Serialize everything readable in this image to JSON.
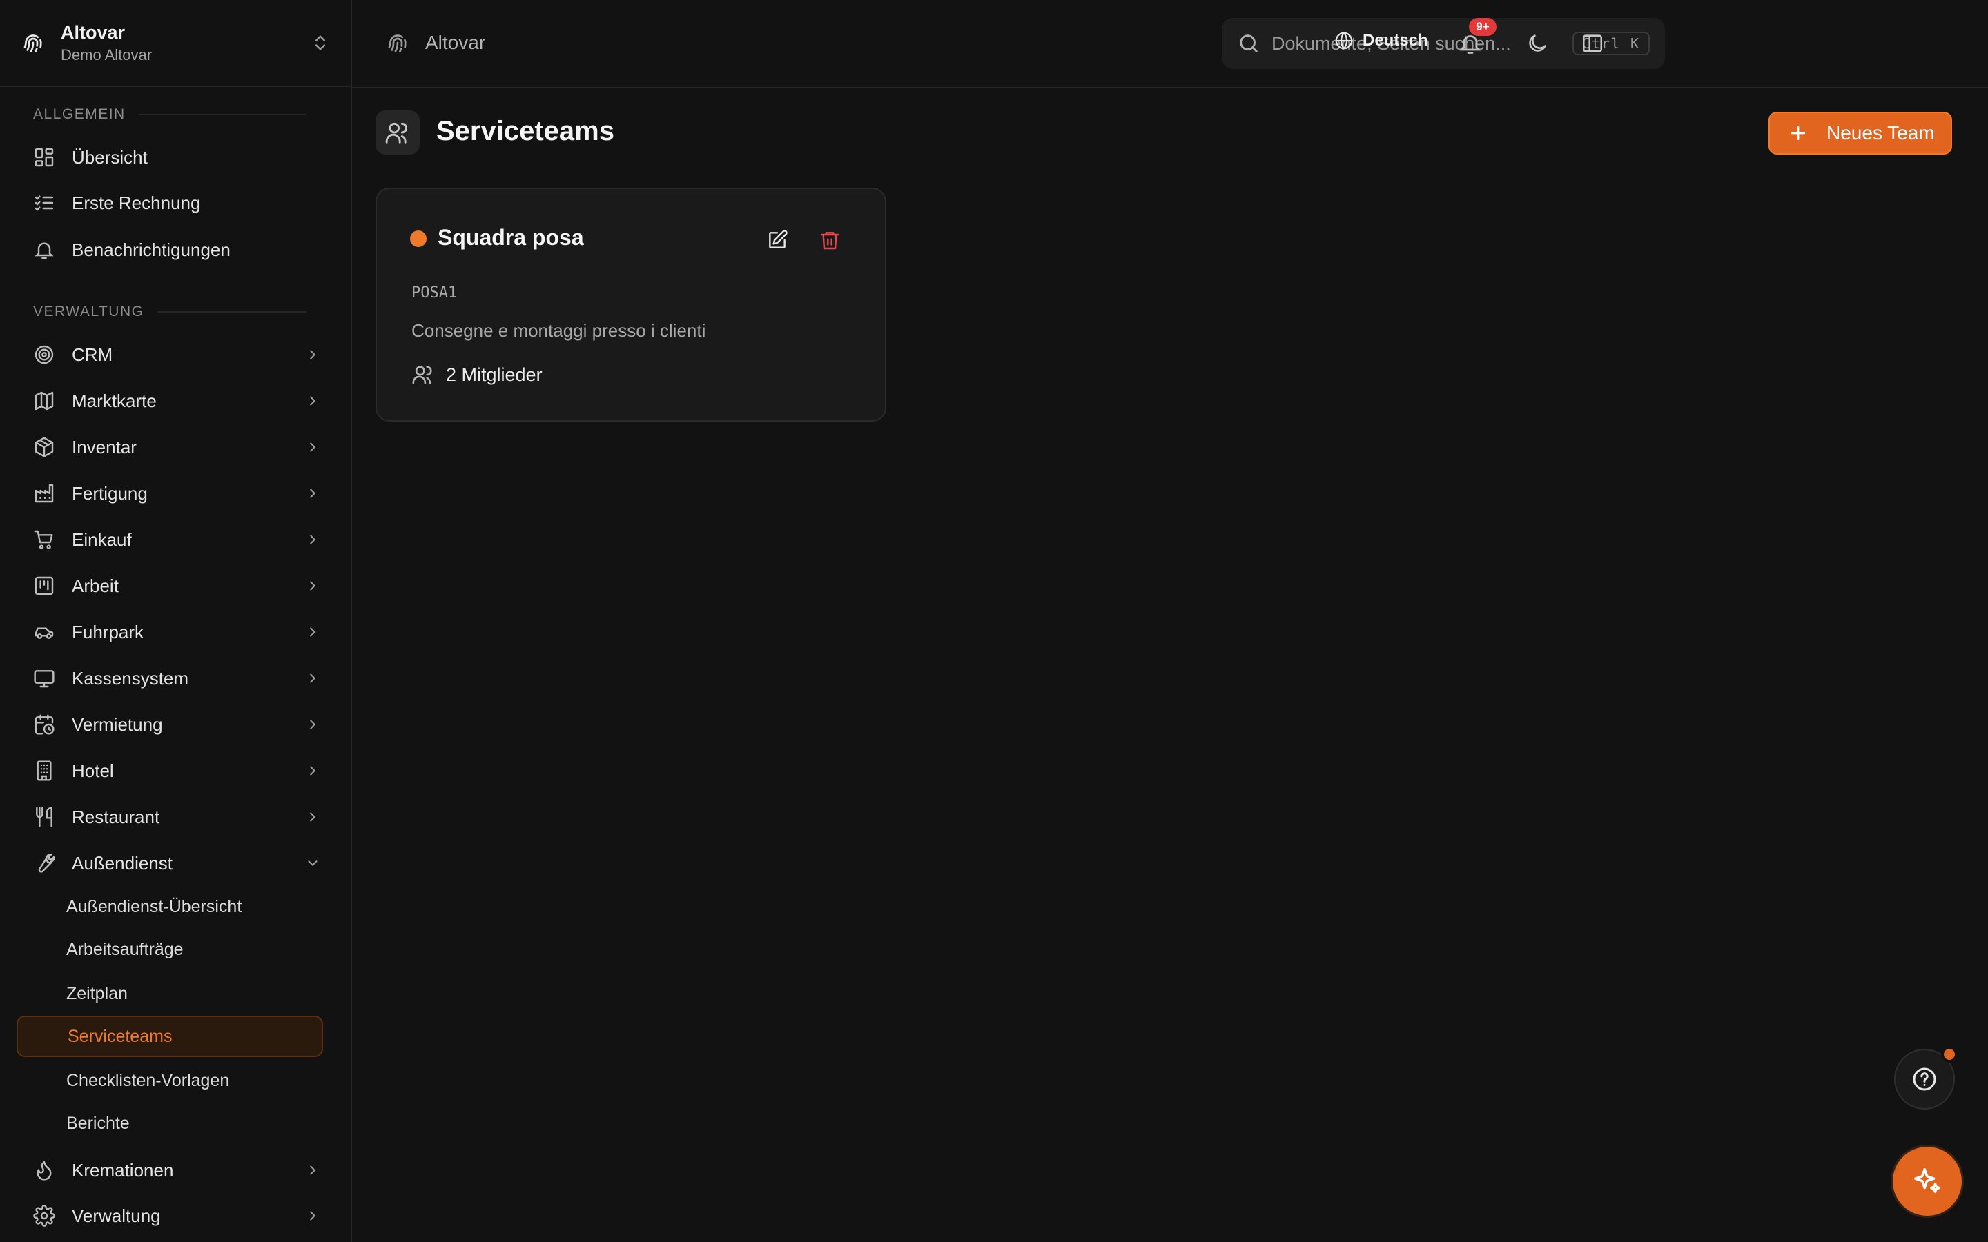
{
  "workspace": {
    "app_name": "Altovar",
    "tenant": "Demo Altovar"
  },
  "breadcrumb": {
    "label": "Altovar"
  },
  "search": {
    "placeholder": "Dokumente, Seiten suchen...",
    "shortcut": "Ctrl K"
  },
  "topbar": {
    "language": "Deutsch",
    "notification_badge": "9+"
  },
  "sidebar": {
    "sections": [
      {
        "label": "ALLGEMEIN"
      },
      {
        "label": "VERWALTUNG"
      }
    ],
    "general_items": [
      {
        "label": "Übersicht",
        "icon": "dashboard-icon"
      },
      {
        "label": "Erste Rechnung",
        "icon": "checklist-icon"
      },
      {
        "label": "Benachrichtigungen",
        "icon": "bell-icon"
      }
    ],
    "admin_items": [
      {
        "label": "CRM",
        "icon": "target-icon"
      },
      {
        "label": "Marktkarte",
        "icon": "map-icon"
      },
      {
        "label": "Inventar",
        "icon": "package-icon"
      },
      {
        "label": "Fertigung",
        "icon": "factory-icon"
      },
      {
        "label": "Einkauf",
        "icon": "cart-icon"
      },
      {
        "label": "Arbeit",
        "icon": "kanban-icon"
      },
      {
        "label": "Fuhrpark",
        "icon": "car-icon"
      },
      {
        "label": "Kassensystem",
        "icon": "monitor-icon"
      },
      {
        "label": "Vermietung",
        "icon": "calendar-clock-icon"
      },
      {
        "label": "Hotel",
        "icon": "building-icon"
      },
      {
        "label": "Restaurant",
        "icon": "utensils-icon"
      },
      {
        "label": "Außendienst",
        "icon": "wrench-icon"
      }
    ],
    "field_service_sub": [
      {
        "label": "Außendienst-Übersicht"
      },
      {
        "label": "Arbeitsaufträge"
      },
      {
        "label": "Zeitplan"
      },
      {
        "label": "Serviceteams",
        "active": true
      },
      {
        "label": "Checklisten-Vorlagen"
      },
      {
        "label": "Berichte"
      }
    ],
    "bottom_items": [
      {
        "label": "Kremationen",
        "icon": "flame-icon"
      },
      {
        "label": "Verwaltung",
        "icon": "gear-icon"
      }
    ]
  },
  "page": {
    "title": "Serviceteams",
    "new_button": "Neues Team"
  },
  "teams": [
    {
      "name": "Squadra posa",
      "code": "POSA1",
      "description": "Consegne e montaggi presso i clienti",
      "members": "2 Mitglieder",
      "color": "#f07a2c"
    }
  ],
  "colors": {
    "accent": "#e1641f",
    "background": "#121212",
    "danger": "#e5484d"
  }
}
